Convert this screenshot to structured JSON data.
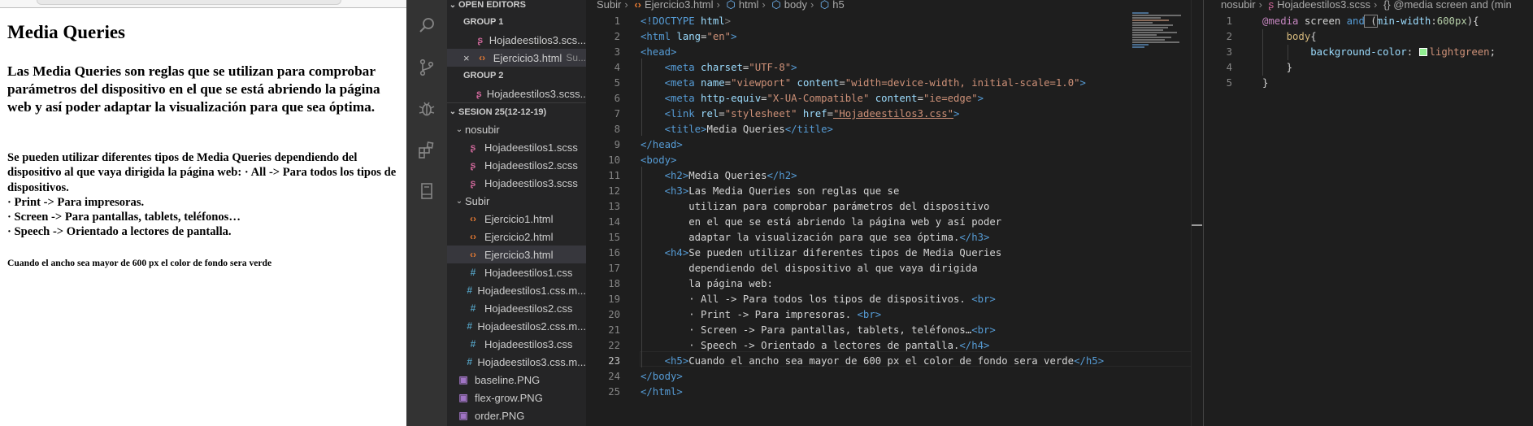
{
  "preview": {
    "h2": "Media Queries",
    "h3": "Las Media Queries son reglas que se utilizan para comprobar parámetros del dispositivo en el que se está abriendo la página web y así poder adaptar la visualización para que sea óptima.",
    "h4_intro": "Se pueden utilizar diferentes tipos de Media Queries dependiendo del dispositivo al que vaya dirigida la página web: · All -> Para todos los tipos de dispositivos.",
    "h4_print": "· Print -> Para impresoras.",
    "h4_screen": "· Screen -> Para pantallas, tablets, teléfonos…",
    "h4_speech": "· Speech -> Orientado a lectores de pantalla.",
    "h5": "Cuando el ancho sea mayor de 600 px el color de fondo sera verde"
  },
  "activity_bar": {
    "icons": [
      "search-icon",
      "source-control-icon",
      "debug-icon",
      "extensions-icon",
      "book-icon"
    ]
  },
  "explorer": {
    "open_editors_label": "OPEN EDITORS",
    "group1_label": "GROUP 1",
    "group1_file": "Hojadeestilos3.scs...",
    "group1_file2": "Ejercicio3.html",
    "group1_file2_hint": "Su...",
    "group2_label": "GROUP 2",
    "group2_file": "Hojadeestilos3.scss...",
    "workspace_label": "SESION 25(12-12-19)",
    "nosubir": "nosubir",
    "nosubir_files": [
      "Hojadeestilos1.scss",
      "Hojadeestilos2.scss",
      "Hojadeestilos3.scss"
    ],
    "subir": "Subir",
    "subir_files": [
      "Ejercicio1.html",
      "Ejercicio2.html",
      "Ejercicio3.html",
      "Hojadeestilos1.css",
      "Hojadeestilos1.css.m...",
      "Hojadeestilos2.css",
      "Hojadeestilos2.css.m...",
      "Hojadeestilos3.css",
      "Hojadeestilos3.css.m..."
    ],
    "root_files": [
      "baseline.PNG",
      "flex-grow.PNG",
      "order.PNG"
    ]
  },
  "editor1": {
    "breadcrumb": [
      "Subir",
      "Ejercicio3.html",
      "html",
      "body",
      "h5"
    ],
    "line_numbers": [
      "1",
      "2",
      "3",
      "4",
      "5",
      "6",
      "7",
      "8",
      "9",
      "10",
      "11",
      "12",
      "13",
      "14",
      "15",
      "16",
      "17",
      "18",
      "19",
      "20",
      "21",
      "22",
      "23",
      "24",
      "25"
    ],
    "code": {
      "l1_tag": "<!DOCTYPE",
      "l1_rest": " html",
      "l2_open": "<html",
      "l2_attr": " lang",
      "l2_val": "\"en\"",
      "l3": "<head>",
      "l4_tag": "<meta",
      "l4_attr": " charset",
      "l4_val": "\"UTF-8\"",
      "l5_tag": "<meta",
      "l5_attr1": " name",
      "l5_val1": "\"viewport\"",
      "l5_attr2": " content",
      "l5_val2": "\"width=device-width, initial-scale=1.0\"",
      "l6_tag": "<meta",
      "l6_attr1": " http-equiv",
      "l6_val1": "\"X-UA-Compatible\"",
      "l6_attr2": " content",
      "l6_val2": "\"ie=edge\"",
      "l7_tag": "<link",
      "l7_attr1": " rel",
      "l7_val1": "\"stylesheet\"",
      "l7_attr2": " href",
      "l7_val2": "\"Hojadeestilos3.css\"",
      "l8_open": "<title>",
      "l8_text": "Media Queries",
      "l8_close": "</title>",
      "l9": "</head>",
      "l10": "<body>",
      "l11_open": "<h2>",
      "l11_text": "Media Queries",
      "l11_close": "</h2>",
      "l12_open": "<h3>",
      "l12_text": "Las Media Queries son reglas que se",
      "l13": "utilizan para comprobar parámetros del dispositivo",
      "l14": "en el que se está abriendo la página web y así poder",
      "l15_text": "adaptar la visualización para que sea óptima.",
      "l15_close": "</h3>",
      "l16_open": "<h4>",
      "l16_text": "Se pueden utilizar diferentes tipos de Media Queries",
      "l17": "dependiendo del dispositivo al que vaya dirigida",
      "l18": "la página web:",
      "l19_text": "· All -> Para todos los tipos de dispositivos. ",
      "l19_tag": "<br>",
      "l20_text": "· Print -> Para impresoras. ",
      "l20_tag": "<br>",
      "l21_text": "· Screen -> Para pantallas, tablets, teléfonos…",
      "l21_tag": "<br>",
      "l22_text": "· Speech -> Orientado a lectores de pantalla.",
      "l22_close": "</h4>",
      "l23_open": "<h5>",
      "l23_text": "Cuando el ancho sea mayor de 600 px el color de fondo sera verde",
      "l23_close": "</h5>",
      "l24": "</body>",
      "l25": "</html>"
    }
  },
  "editor2": {
    "breadcrumb": [
      "nosubir",
      "Hojadeestilos3.scss",
      "{} @media screen and (min"
    ],
    "line_numbers": [
      "1",
      "2",
      "3",
      "4",
      "5"
    ],
    "code": {
      "l1_kw": "@media",
      "l1_rest": " screen ",
      "l1_and": "and",
      "l1_paren_open": " (",
      "l1_prop": "min-width",
      "l1_colon": ":",
      "l1_num": "600px",
      "l1_end": "){",
      "l2_sel": "body",
      "l2_brace": "{",
      "l3_prop": "background-color",
      "l3_colon": ": ",
      "l3_val": "lightgreen",
      "l3_semi": ";",
      "l4": "}",
      "l5": "}"
    },
    "swatch_color": "#90ee90"
  }
}
